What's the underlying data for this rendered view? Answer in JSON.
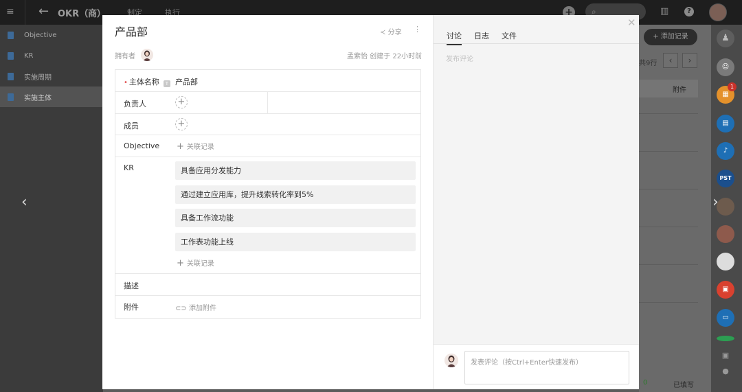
{
  "app": {
    "title": "OKR（商）",
    "tabs": [
      "制定",
      "执行"
    ],
    "sidebar": [
      "Objective",
      "KR",
      "实施周期",
      "实施主体"
    ],
    "add_record": "添加记录",
    "count_fragment": "共9行",
    "column_attachment": "附件",
    "footer_filled": "已填写",
    "footer_count": "0",
    "rail_badge": "1",
    "rail_badge_pst": "PST"
  },
  "modal": {
    "title": "产品部",
    "share_label": "分享",
    "owner_label": "拥有者",
    "meta": "孟紫怡 创建于 22小时前",
    "fields": {
      "subject_label": "主体名称",
      "subject_value": "产品部",
      "leader_label": "负责人",
      "members_label": "成员",
      "objective_label": "Objective",
      "link_record": "关联记录",
      "kr_label": "KR",
      "kr_items": [
        "具备应用分发能力",
        "通过建立应用库，提升线索转化率到5%",
        "具备工作流功能",
        "工作表功能上线"
      ],
      "description_label": "描述",
      "attachment_label": "附件",
      "add_attachment": "添加附件"
    }
  },
  "discussion": {
    "tabs": [
      "讨论",
      "日志",
      "文件"
    ],
    "active_tab": "讨论",
    "placeholder": "发布评论",
    "composer_placeholder": "发表评论（按Ctrl+Enter快速发布）"
  },
  "colors": {
    "accent_req": "#e25353",
    "doc_icon": "#3d6a98",
    "rail_orange": "#e4912b",
    "rail_blue": "#1e6fb5",
    "rail_red": "#d9412f",
    "rail_green": "#2c9e52"
  }
}
